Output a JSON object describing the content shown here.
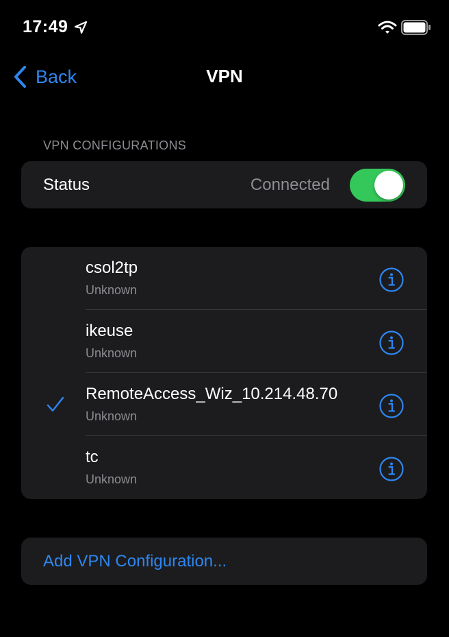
{
  "status_bar": {
    "time": "17:49",
    "icons": [
      "location-arrow-icon",
      "wifi-icon",
      "battery-icon"
    ]
  },
  "nav": {
    "back_label": "Back",
    "title": "VPN"
  },
  "section": {
    "header": "VPN CONFIGURATIONS"
  },
  "status_row": {
    "label": "Status",
    "value": "Connected",
    "toggle_on": true
  },
  "configurations": [
    {
      "name": "csol2tp",
      "status": "Unknown",
      "selected": false
    },
    {
      "name": "ikeuse",
      "status": "Unknown",
      "selected": false
    },
    {
      "name": "RemoteAccess_Wiz_10.214.48.70",
      "status": "Unknown",
      "selected": true
    },
    {
      "name": "tc",
      "status": "Unknown",
      "selected": false
    }
  ],
  "add_configuration": {
    "label": "Add VPN Configuration..."
  },
  "colors": {
    "background": "#000000",
    "group_background": "#1c1c1e",
    "accent": "#2e86f0",
    "toggle_on": "#34c759",
    "secondary_text": "#8d8d93",
    "separator": "#38383a"
  }
}
